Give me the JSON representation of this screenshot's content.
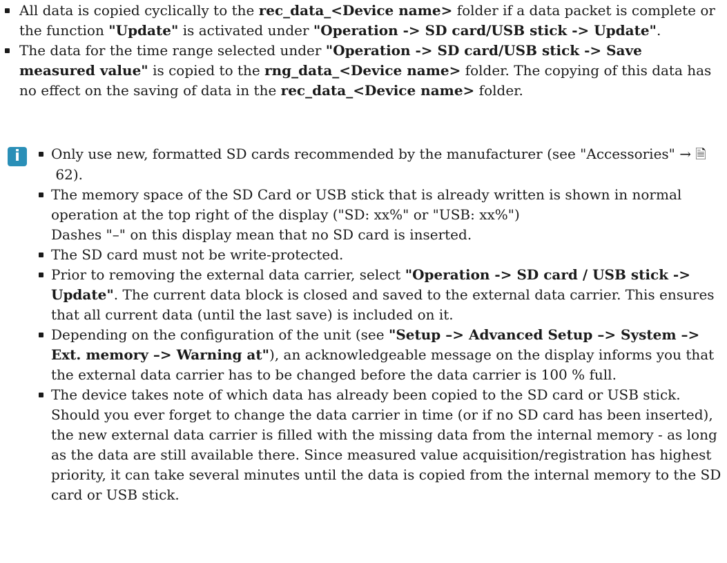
{
  "top_bullets": [
    {
      "t1": "All data is copied cyclically to the ",
      "b1": "rec_data_<Device name>",
      "t2": " folder if a data packet is complete or the function ",
      "b2": "\"Update\"",
      "t3": " is activated under ",
      "b3": "\"Operation -> SD card/USB stick -> Update\"",
      "t4": "."
    },
    {
      "t1": "The data for the time range selected under ",
      "b1": "\"Operation -> SD card/USB stick -> Save measured value\"",
      "t2": " is copied to the ",
      "b2": "rng_data_<Device name>",
      "t3": " folder. The copying of this data has no effect on the saving of data in the ",
      "b3": "rec_data_<Device name>",
      "t4": " folder."
    }
  ],
  "note": {
    "icon_glyph": "i",
    "icon_color": "#2a8fb7",
    "b1": {
      "t1": "Only use new, formatted SD cards recommended by the manufacturer (see \"Accessories\" → ",
      "book_glyph": "🗎",
      "page_ref": "62",
      "t2": ")."
    },
    "b2": {
      "line1": "The memory space of the SD Card or USB stick that is already written is shown in normal operation at the top right of the display (\"SD: xx%\" or \"USB: xx%\")",
      "line2": "Dashes \"–\" on this display mean that no SD card is inserted."
    },
    "b3": "The SD card must not be write-protected.",
    "b4": {
      "t1": "Prior to removing the external data carrier, select ",
      "b1": "\"Operation -> SD card / USB stick -> Update\"",
      "t2": ". The current data block is closed and saved to the external data carrier. This ensures that all current data (until the last save) is included on it."
    },
    "b5": {
      "t1": "Depending on the configuration of the unit (see ",
      "b1": "\"Setup –> Advanced Setup –> System –> Ext. memory –> Warning at\"",
      "t2": "), an acknowledgeable message on the display informs you that the external data carrier has to be changed before the data carrier is 100 % full."
    },
    "b6": "The device takes note of which data has already been copied to the SD card or USB stick. Should you ever forget to change the data carrier in time (or if no SD card has been inserted), the new external data carrier is filled with the missing data from the internal memory - as long as the data are still available there. Since measured value acquisition/registration has highest priority, it can take several minutes until the data is copied from the internal memory to the SD card or USB stick."
  }
}
